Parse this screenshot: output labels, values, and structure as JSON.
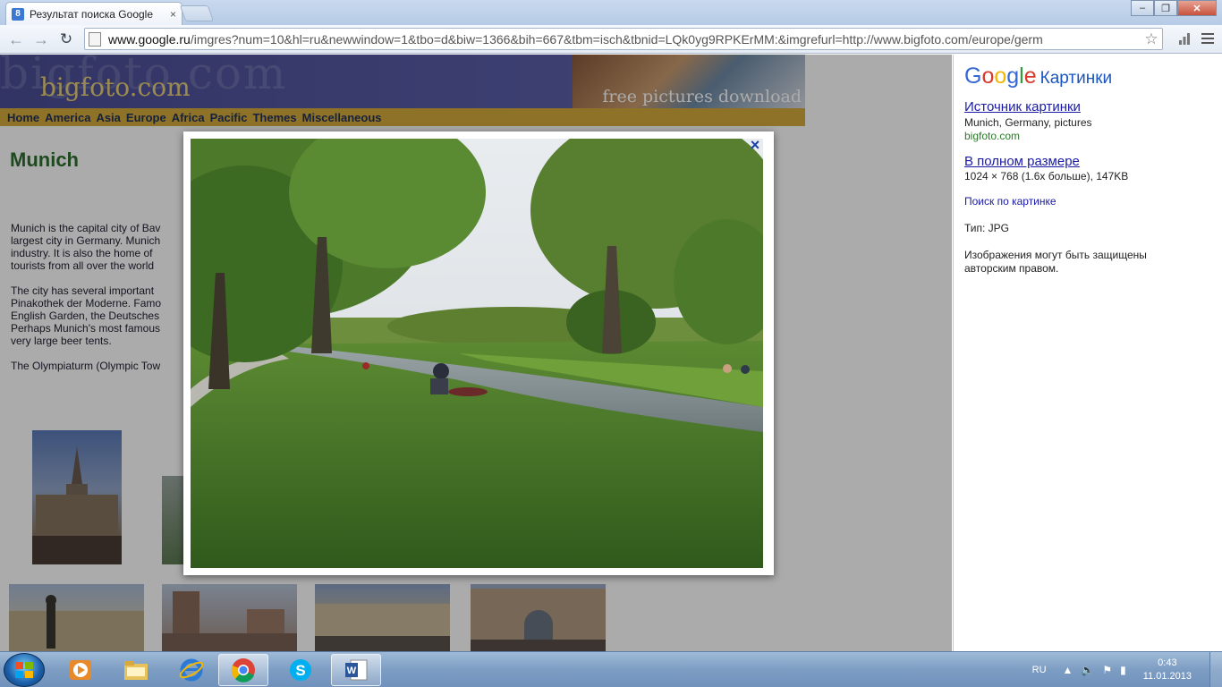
{
  "browser": {
    "tab_title": "Результат поиска Google",
    "tab_close": "×",
    "favicon_letter": "8",
    "url_host": "www.google.ru",
    "url_rest": "/imgres?num=10&hl=ru&newwindow=1&tbo=d&biw=1366&bih=667&tbm=isch&tbnid=LQk0yg9RPKErMM:&imgrefurl=http://www.bigfoto.com/europe/germ",
    "back_icon": "←",
    "forward_icon": "→",
    "reload_icon": "↻",
    "star_icon": "☆",
    "minimize": "–",
    "maximize": "❐",
    "close": "✕"
  },
  "site": {
    "logo_bg": "bigfoto.com",
    "logo": "bigfoto.com",
    "tagline": "free pictures download",
    "nav": [
      "Home",
      "America",
      "Asia",
      "Europe",
      "Africa",
      "Pacific",
      "Themes",
      "Miscellaneous"
    ],
    "heading": "Munich",
    "paragraphs": [
      "Munich is the capital city of Bav",
      "largest city in Germany. Munich",
      "industry. It is also the home of",
      "tourists from all over the world",
      "The city has several important",
      "Pinakothek der Moderne. Famo",
      "English Garden, the Deutsches",
      "Perhaps Munich's most famous",
      "very large beer tents.",
      "The Olympiaturm (Olympic Tow"
    ]
  },
  "lightbox": {
    "close_icon": "×"
  },
  "panel": {
    "brand_letters": [
      "G",
      "o",
      "o",
      "g",
      "l",
      "e"
    ],
    "brand_colors": [
      "#3568d4",
      "#d8392b",
      "#f2b600",
      "#3568d4",
      "#2f9d3e",
      "#d8392b"
    ],
    "images_word": "Картинки",
    "source_link": "Источник картинки",
    "source_desc": "Munich, Germany, pictures",
    "source_domain": "bigfoto.com",
    "full_link": "В полном размере",
    "full_desc": "1024 × 768 (1.6x больше), 147KB",
    "search_by_image": "Поиск по картинке",
    "type": "Тип:  JPG",
    "copyright": "Изображения могут быть защищены авторским правом."
  },
  "taskbar": {
    "lang": "RU",
    "tray_up": "▲",
    "volume": "🔈",
    "flag": "⚑",
    "network": "▮",
    "time": "0:43",
    "date": "11.01.2013"
  }
}
